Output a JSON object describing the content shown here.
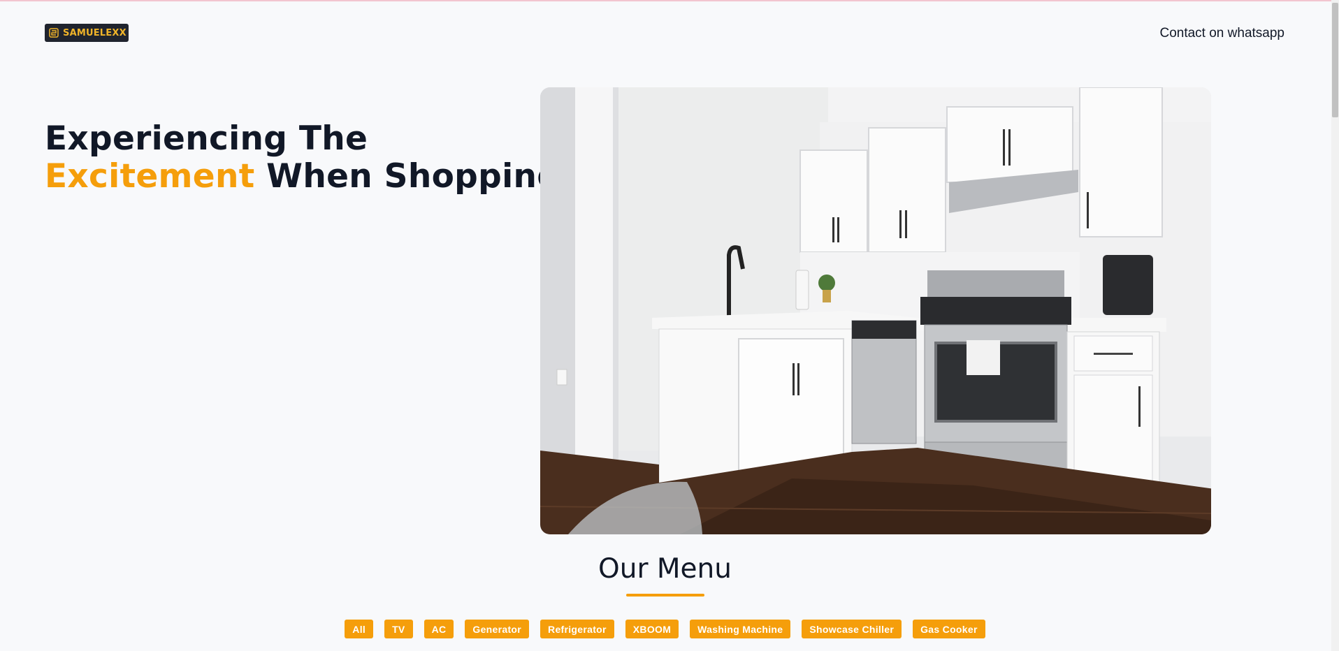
{
  "header": {
    "logo_text": "SAMUELEXX",
    "logo_icon": "grid-logo-icon",
    "contact_label": "Contact on whatsapp"
  },
  "hero": {
    "title_line1": "Experiencing The",
    "title_accent": "Excitement",
    "title_rest": " When Shopping"
  },
  "menu": {
    "title": "Our Menu",
    "filters": [
      "All",
      "TV",
      "AC",
      "Generator",
      "Refrigerator",
      "XBOOM",
      "Washing Machine",
      "Showcase Chiller",
      "Gas Cooker"
    ]
  },
  "colors": {
    "accent": "#f59e0b",
    "text": "#111827",
    "background": "#f8f9fb"
  }
}
